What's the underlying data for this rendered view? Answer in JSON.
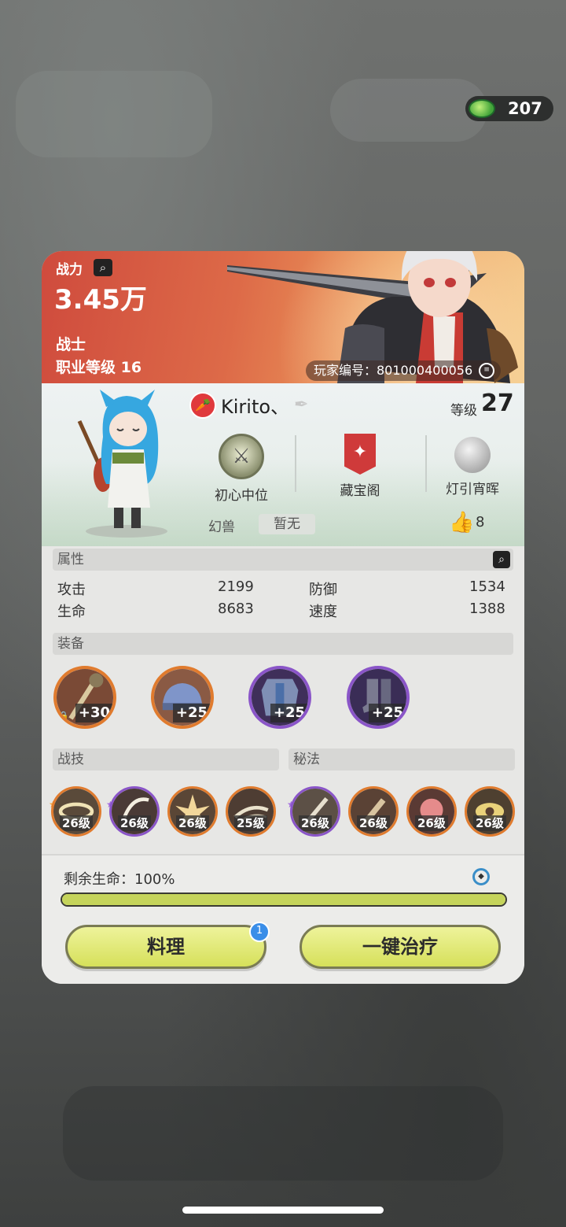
{
  "currency": {
    "amount": "207"
  },
  "header": {
    "power_label": "战力",
    "power_value": "3.45万",
    "class_name": "战士",
    "class_level": "职业等级 16",
    "player_id": "玩家编号：801000400056"
  },
  "profile": {
    "name": "Kirito、",
    "level_label": "等级",
    "level_value": "27",
    "ranks": [
      {
        "label": "初心中位"
      },
      {
        "label": "藏宝阁"
      },
      {
        "label": "灯引宵晖"
      }
    ],
    "pet_label": "幻兽",
    "pet_value": "暂无",
    "likes": "8"
  },
  "attributes": {
    "title": "属性",
    "items": [
      {
        "name": "攻击",
        "value": "2199"
      },
      {
        "name": "生命",
        "value": "8683"
      },
      {
        "name": "防御",
        "value": "1534"
      },
      {
        "name": "速度",
        "value": "1388"
      }
    ]
  },
  "equipment": {
    "title": "装备",
    "items": [
      {
        "plus": "+30",
        "rarity": "legendary",
        "locked": true
      },
      {
        "plus": "+25",
        "rarity": "legendary"
      },
      {
        "plus": "+25",
        "rarity": "epic"
      },
      {
        "plus": "+25",
        "rarity": "epic"
      }
    ]
  },
  "skills": {
    "combat_title": "战技",
    "secret_title": "秘法",
    "items": [
      {
        "level": "26级",
        "rarity": "legendary"
      },
      {
        "level": "26级",
        "rarity": "epic"
      },
      {
        "level": "26级",
        "rarity": "legendary"
      },
      {
        "level": "25级",
        "rarity": "legendary"
      },
      {
        "level": "26级",
        "rarity": "epic"
      },
      {
        "level": "26级",
        "rarity": "legendary"
      },
      {
        "level": "26级",
        "rarity": "legendary"
      },
      {
        "level": "26级",
        "rarity": "legendary"
      }
    ]
  },
  "status": {
    "hp_label": "剩余生命：100%",
    "hp_percent": 100,
    "cook_button": "料理",
    "cook_badge": "1",
    "heal_button": "一键治疗"
  },
  "colors": {
    "legendary": "#e07b2e",
    "epic": "#8a55c8",
    "hp_fill": "#c5d45b",
    "button": "#d6e05a"
  }
}
